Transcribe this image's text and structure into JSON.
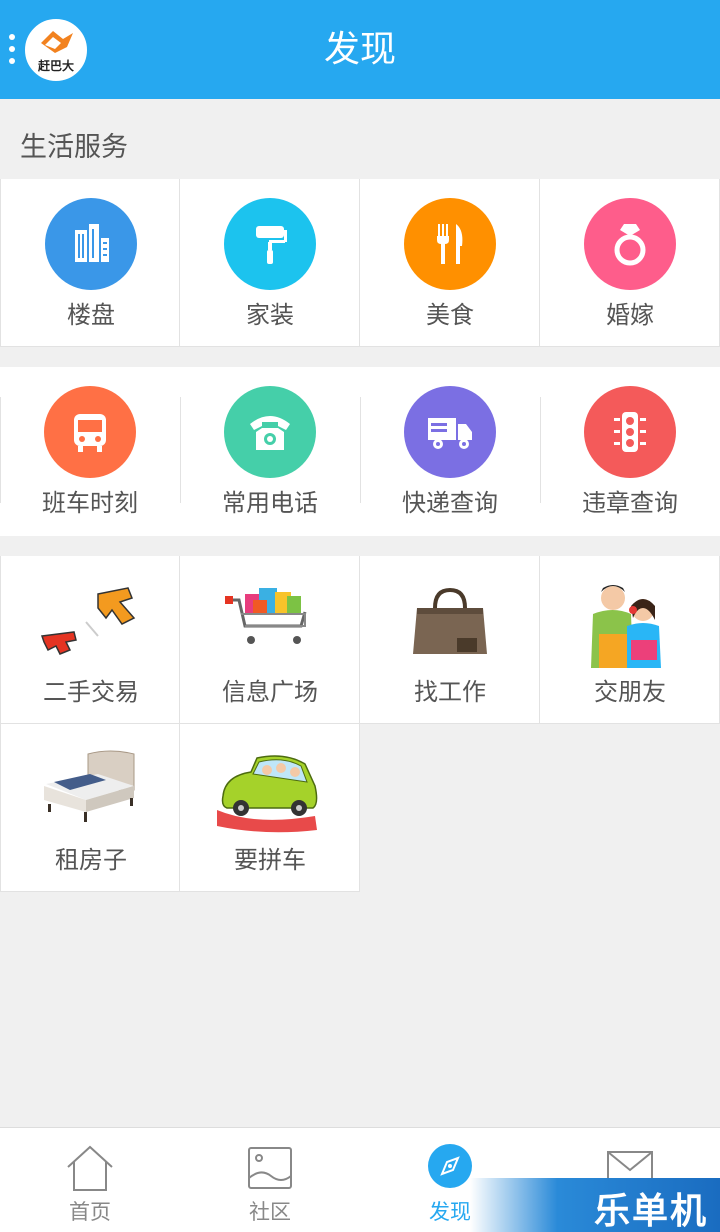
{
  "header": {
    "title": "发现",
    "avatar_text": "赶巴大"
  },
  "section": {
    "title": "生活服务"
  },
  "services_row1": [
    {
      "label": "楼盘",
      "icon": "building-icon",
      "color": "#3a97e8"
    },
    {
      "label": "家装",
      "icon": "paint-roller-icon",
      "color": "#1cc3ee"
    },
    {
      "label": "美食",
      "icon": "fork-knife-icon",
      "color": "#ff9000"
    },
    {
      "label": "婚嫁",
      "icon": "ring-icon",
      "color": "#fe5d8b"
    }
  ],
  "services_row2": [
    {
      "label": "班车时刻",
      "icon": "bus-icon",
      "color": "#ff7045"
    },
    {
      "label": "常用电话",
      "icon": "telephone-icon",
      "color": "#45cfa9"
    },
    {
      "label": "快递查询",
      "icon": "delivery-truck-icon",
      "color": "#7b6fe3"
    },
    {
      "label": "违章查询",
      "icon": "traffic-light-icon",
      "color": "#f45a5a"
    }
  ],
  "services_row3": [
    {
      "label": "二手交易",
      "icon": "buy-sell-icon"
    },
    {
      "label": "信息广场",
      "icon": "shopping-cart-icon"
    },
    {
      "label": "找工作",
      "icon": "briefcase-icon"
    },
    {
      "label": "交朋友",
      "icon": "friends-icon"
    }
  ],
  "services_row4": [
    {
      "label": "租房子",
      "icon": "bed-icon"
    },
    {
      "label": "要拼车",
      "icon": "car-icon"
    }
  ],
  "tabs": [
    {
      "label": "首页",
      "icon": "home-icon"
    },
    {
      "label": "社区",
      "icon": "image-icon"
    },
    {
      "label": "发现",
      "icon": "compass-icon",
      "active": true
    },
    {
      "label": "",
      "icon": "mail-icon"
    }
  ],
  "watermark": "乐单机"
}
